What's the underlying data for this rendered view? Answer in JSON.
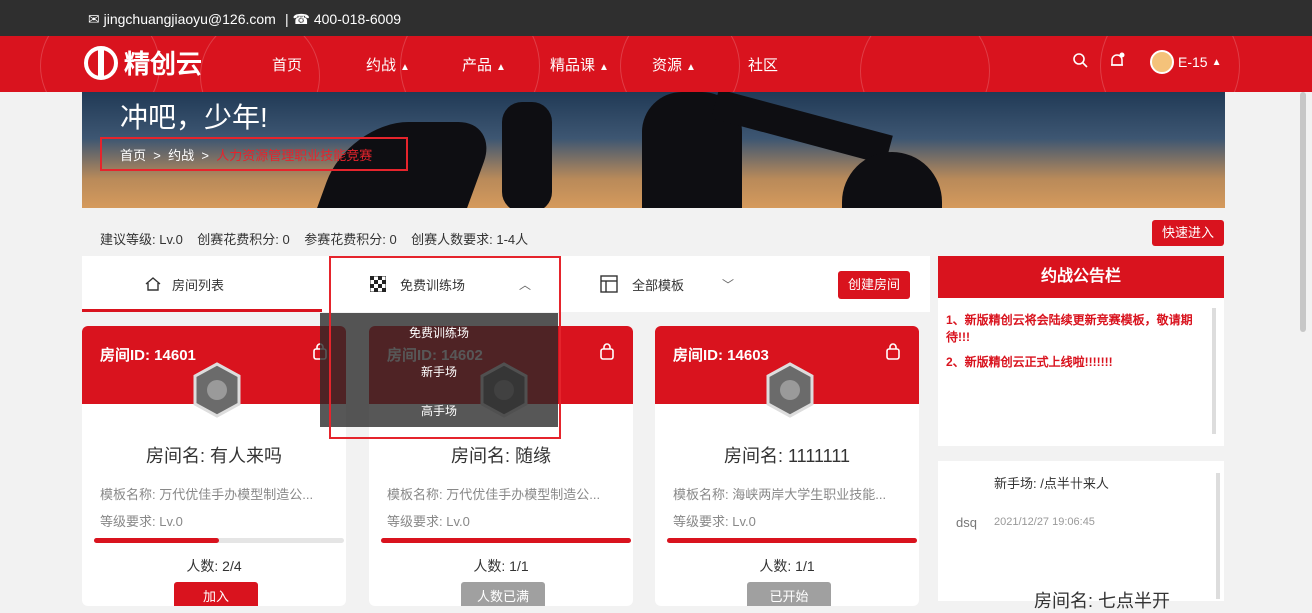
{
  "topbar": {
    "email": "jingchuangjiaoyu@126.com",
    "phone": "400-018-6009"
  },
  "nav": {
    "brand": "精创云",
    "items": [
      {
        "label": "首页",
        "caret": false
      },
      {
        "label": "约战",
        "caret": true
      },
      {
        "label": "产品",
        "caret": true
      },
      {
        "label": "精品课",
        "caret": true
      },
      {
        "label": "资源",
        "caret": true
      },
      {
        "label": "社区",
        "caret": false
      }
    ],
    "user": "E-15"
  },
  "banner": {
    "slogan": "冲吧，少年!",
    "breadcrumb": [
      "首页",
      "约战",
      "人力资源管理职业技能竞赛"
    ]
  },
  "info": {
    "level": "建议等级: Lv.0",
    "create_cost": "创赛花费积分: 0",
    "join_cost": "参赛花费积分: 0",
    "players": "创赛人数要求: 1-4人",
    "quick_enter": "快速进入"
  },
  "tabs": {
    "room_list": "房间列表",
    "training": "免费训练场",
    "all_templates": "全部模板",
    "create_room": "创建房间"
  },
  "dropdown": [
    "免费训练场",
    "新手场",
    "高手场"
  ],
  "rooms": [
    {
      "id": "房间ID: 14601",
      "name": "房间名: 有人来吗",
      "template": "模板名称: 万代优佳手办模型制造公...",
      "level": "等级要求: Lv.0",
      "fill": 0.5,
      "count": "人数: 2/4",
      "action": "加入",
      "action_color": "#d9131e"
    },
    {
      "id": "房间ID: 14602",
      "name": "房间名: 随缘",
      "template": "模板名称: 万代优佳手办模型制造公...",
      "level": "等级要求: Lv.0",
      "fill": 1.0,
      "count": "人数: 1/1",
      "action": "人数已满",
      "action_color": "#a0a0a0"
    },
    {
      "id": "房间ID: 14603",
      "name": "房间名: 1111111",
      "template": "模板名称: 海峡两岸大学生职业技能...",
      "level": "等级要求: Lv.0",
      "fill": 1.0,
      "count": "人数: 1/1",
      "action": "已开始",
      "action_color": "#a0a0a0"
    }
  ],
  "board": {
    "title": "约战公告栏",
    "messages": [
      "1、新版精创云将会陆续更新竞赛模板，敬请期待!!!",
      "2、新版精创云正式上线啦!!!!!!!"
    ]
  },
  "chat": {
    "room_title": "新手场: /点半卄来人",
    "user": "dsq",
    "time": "2021/12/27 19:06:45",
    "room_name": "房间名: 七点半开"
  },
  "colors": {
    "brand_red": "#d9131e",
    "disabled": "#a0a0a0"
  }
}
